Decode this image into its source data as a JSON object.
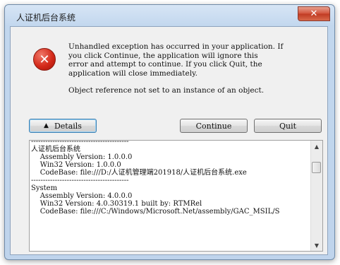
{
  "window": {
    "title": "人证机后台系统",
    "close_glyph": "✕"
  },
  "icon": {
    "name": "error-icon",
    "glyph": "✕"
  },
  "message": {
    "line1": "Unhandled exception has occurred in your application. If\nyou click Continue, the application will ignore this\nerror and attempt to continue. If you click Quit, the\napplication will close immediately.",
    "line2": "Object reference not set to an instance of an object."
  },
  "buttons": {
    "details": "Details",
    "details_arrow": "▲",
    "continue": "Continue",
    "quit": "Quit"
  },
  "details": {
    "text": "-----------------------------------------\n人证机后台系统\n    Assembly Version: 1.0.0.0\n    Win32 Version: 1.0.0.0\n    CodeBase: file:///D:/人证机管理端201918/人证机后台系统.exe\n-----------------------------------------\nSystem\n    Assembly Version: 4.0.0.0\n    Win32 Version: 4.0.30319.1 built by: RTMRel\n    CodeBase: file:///C:/Windows/Microsoft.Net/assembly/GAC_MSIL/S"
  },
  "scrollbar": {
    "up": "▲",
    "down": "▼"
  }
}
